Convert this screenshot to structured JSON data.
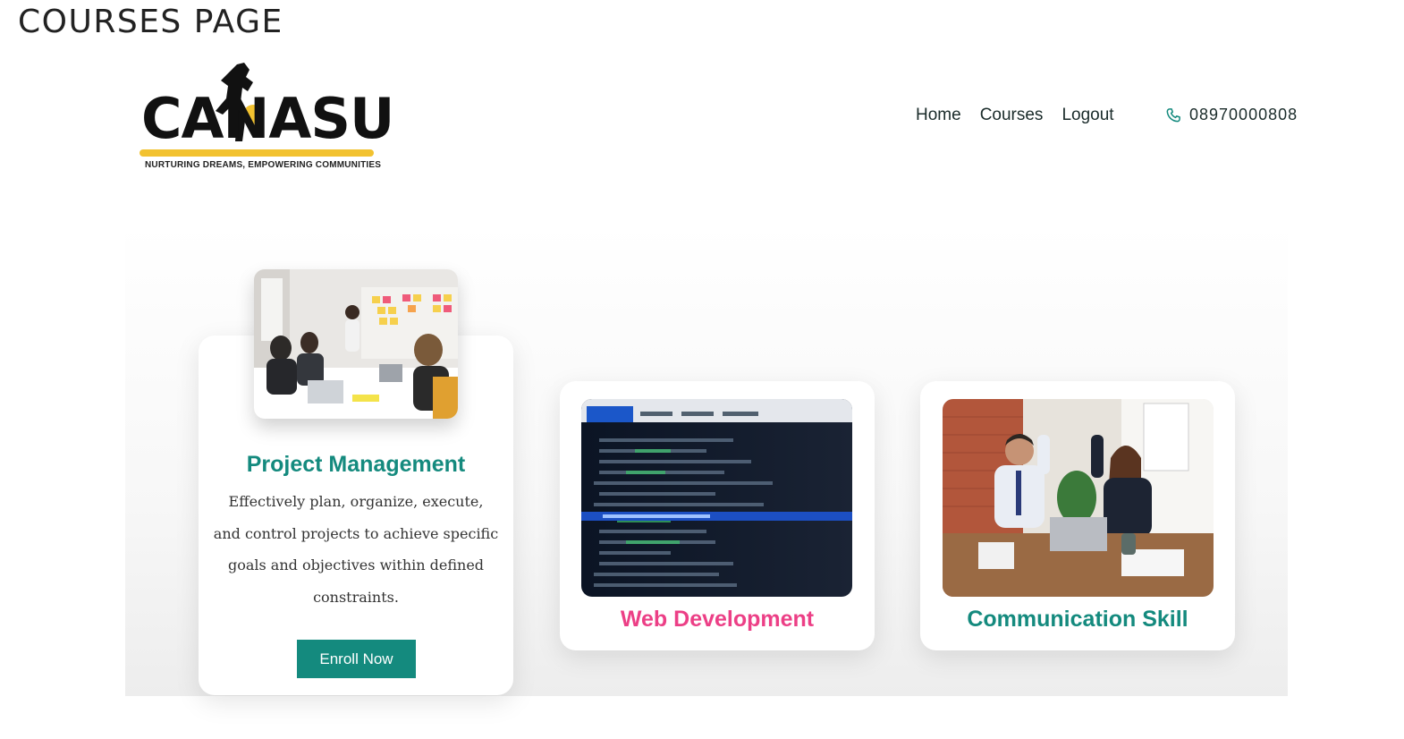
{
  "page": {
    "caption": "COURSES PAGE"
  },
  "brand": {
    "logo_text": "CANASU",
    "tagline": "NURTURING DREAMS, EMPOWERING COMMUNITIES"
  },
  "nav": {
    "items": [
      {
        "label": "Home"
      },
      {
        "label": "Courses"
      },
      {
        "label": "Logout"
      }
    ]
  },
  "contact": {
    "phone": "08970000808",
    "icon": "phone-icon"
  },
  "courses": [
    {
      "title": "Project Management",
      "description": "Effectively plan, organize, execute, and control projects to achieve specific goals and objectives within defined constraints.",
      "button_label": "Enroll Now",
      "title_color": "#148a7e"
    },
    {
      "title": "Web Development",
      "title_color": "#ec3f86"
    },
    {
      "title": "Communication Skill",
      "title_color": "#148a7e"
    }
  ],
  "colors": {
    "accent": "#148a7e",
    "pink": "#ec3f86",
    "logo_yellow": "#f2c230"
  }
}
